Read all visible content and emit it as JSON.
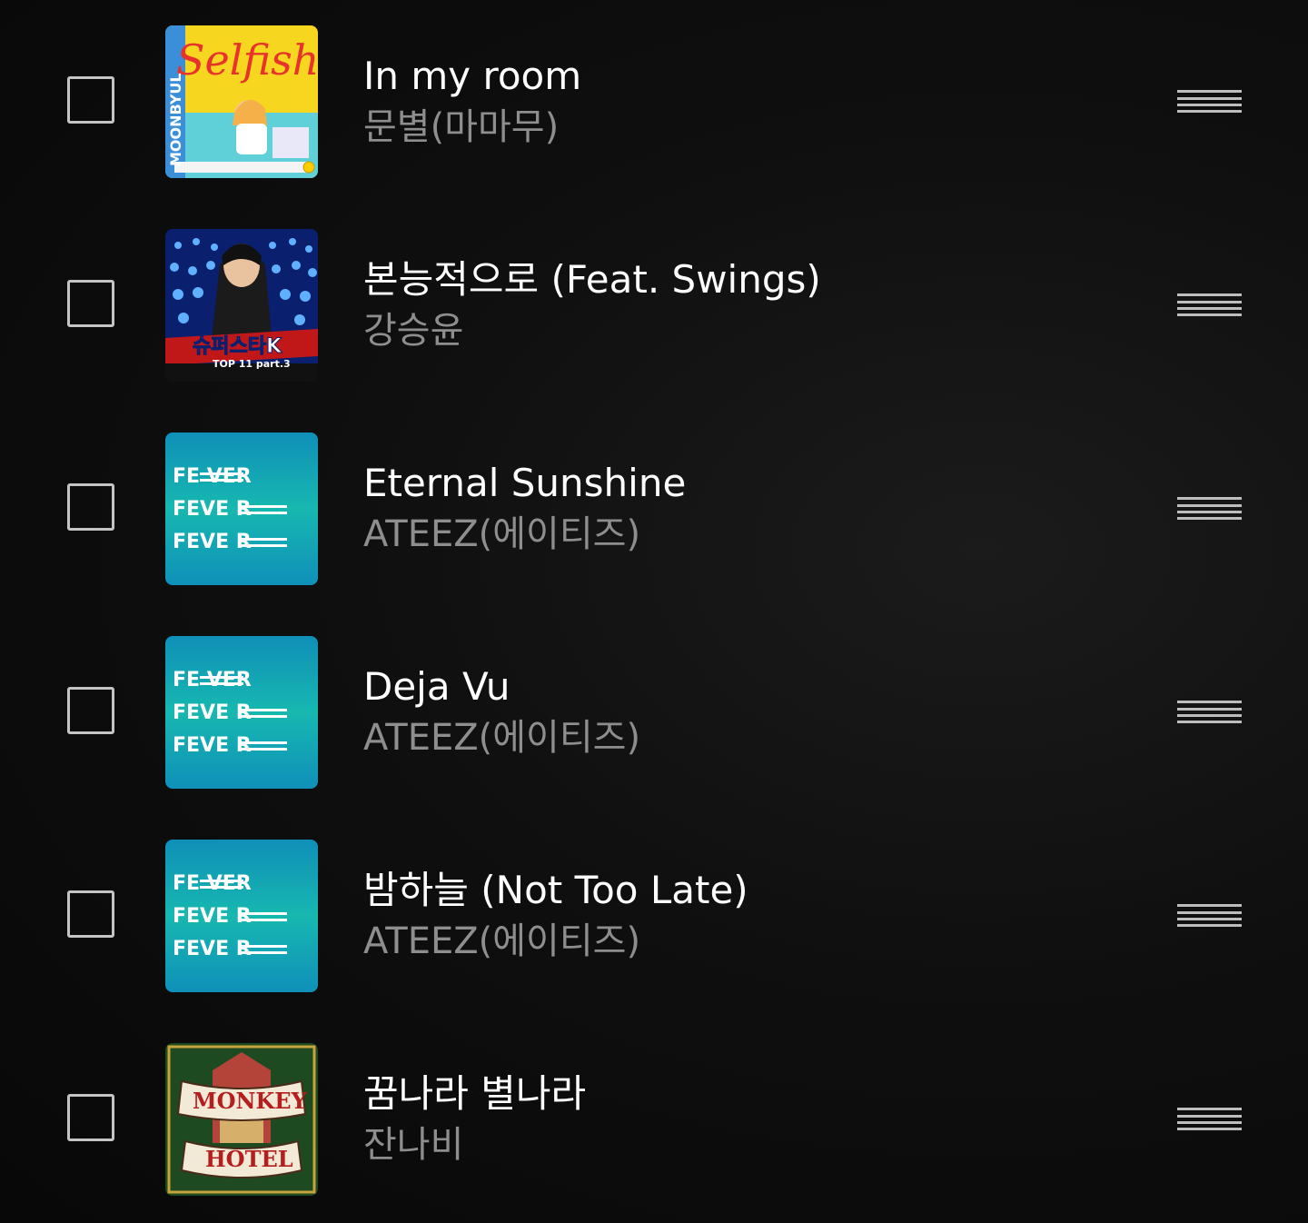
{
  "playlist": {
    "tracks": [
      {
        "title": "In my room",
        "artist": "문별(마마무)",
        "cover": "selfish-cover",
        "cover_text": "Selfish",
        "cover_side_text": "MOONBYUL"
      },
      {
        "title": "본능적으로 (Feat. Swings)",
        "artist": "강승윤",
        "cover": "superstar-k-cover",
        "cover_text": "슈퍼스타K",
        "cover_sub_text": "TOP 11 part.3"
      },
      {
        "title": "Eternal Sunshine",
        "artist": "ATEEZ(에이티즈)",
        "cover": "zero-fever-cover",
        "cover_lines": [
          "FE VER",
          "FEVE R",
          "FEVE R"
        ]
      },
      {
        "title": "Deja Vu",
        "artist": "ATEEZ(에이티즈)",
        "cover": "zero-fever-cover",
        "cover_lines": [
          "FE VER",
          "FEVE R",
          "FEVE R"
        ]
      },
      {
        "title": "밤하늘 (Not Too Late)",
        "artist": "ATEEZ(에이티즈)",
        "cover": "zero-fever-cover",
        "cover_lines": [
          "FE VER",
          "FEVE R",
          "FEVE R"
        ]
      },
      {
        "title": "꿈나라 별나라",
        "artist": "잔나비",
        "cover": "monkey-hotel-cover",
        "cover_text": "MONKEY",
        "cover_sub_text": "HOTEL"
      }
    ]
  },
  "colors": {
    "background": "#0d0d0d",
    "title": "#ffffff",
    "artist": "#8e8e8e",
    "checkbox_border": "#c4c4c4",
    "drag_handle": "#bdbdbd"
  },
  "icons": {
    "checkbox": "checkbox-unchecked-icon",
    "drag_handle": "drag-handle-icon"
  }
}
